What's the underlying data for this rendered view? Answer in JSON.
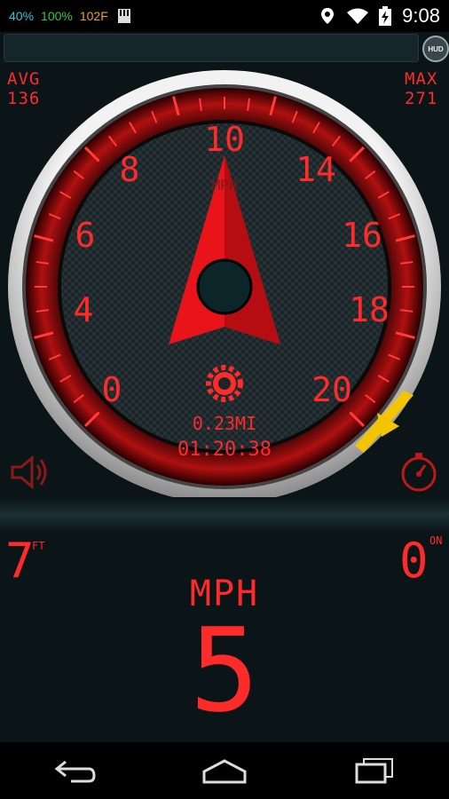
{
  "status_bar": {
    "cpu": "40%",
    "battery_pct": "100%",
    "temp": "102F",
    "time": "9:08"
  },
  "hud_label": "HUD",
  "avg": {
    "label": "AVG",
    "value": "136"
  },
  "max": {
    "label": "MAX",
    "value": "271"
  },
  "gauge": {
    "ticks": [
      "0",
      "4",
      "6",
      "8",
      "10",
      "14",
      "16",
      "18",
      "20"
    ],
    "unit": "MPH",
    "distance": "0.23MI",
    "elapsed": "01:20:38"
  },
  "altitude": {
    "value": "7",
    "unit": "FT"
  },
  "heading": {
    "value": "0",
    "unit": "ON"
  },
  "speed": {
    "unit": "MPH",
    "value": "5"
  },
  "colors": {
    "accent": "#ff2a2a",
    "marker": "#f5c400"
  }
}
